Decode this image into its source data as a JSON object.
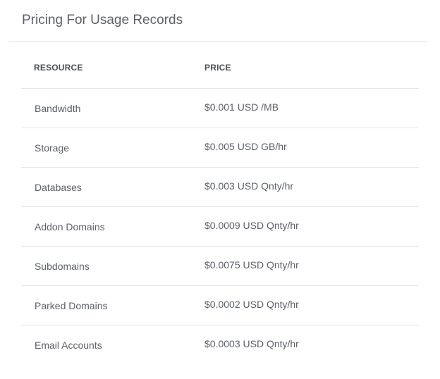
{
  "panel": {
    "title": "Pricing For Usage Records"
  },
  "table": {
    "headers": {
      "resource": "RESOURCE",
      "price": "PRICE"
    },
    "rows": [
      {
        "resource": "Bandwidth",
        "price": "$0.001 USD /MB"
      },
      {
        "resource": "Storage",
        "price": "$0.005 USD GB/hr"
      },
      {
        "resource": "Databases",
        "price": "$0.003 USD Qnty/hr"
      },
      {
        "resource": "Addon Domains",
        "price": "$0.0009 USD Qnty/hr"
      },
      {
        "resource": "Subdomains",
        "price": "$0.0075 USD Qnty/hr"
      },
      {
        "resource": "Parked Domains",
        "price": "$0.0002 USD Qnty/hr"
      },
      {
        "resource": "Email Accounts",
        "price": "$0.0003 USD Qnty/hr"
      }
    ]
  }
}
